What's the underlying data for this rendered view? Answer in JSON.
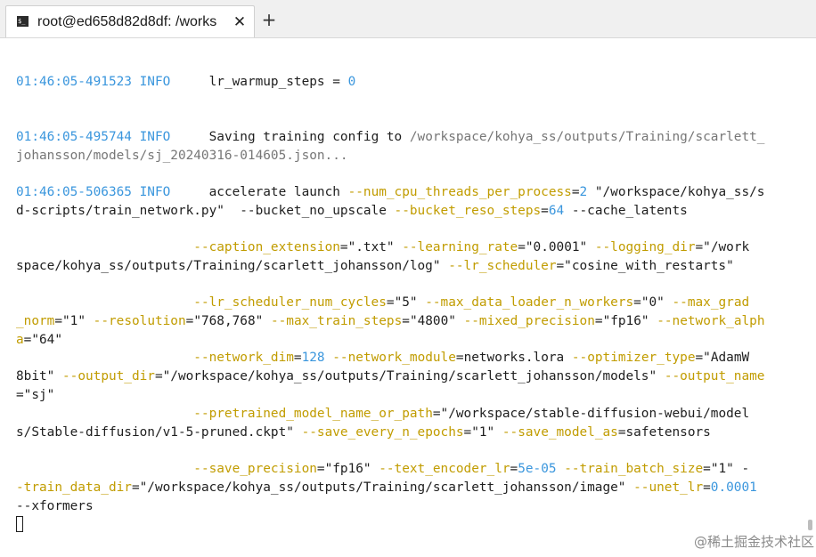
{
  "tab": {
    "title": "root@ed658d82d8df: /works",
    "icon": "terminal-icon",
    "icon_text": "$_",
    "close_glyph": "✕",
    "new_tab_glyph": "+"
  },
  "log": {
    "l1": {
      "ts": "01:46:05-491523",
      "lvl": "INFO",
      "msg": "lr_warmup_steps = ",
      "val": "0"
    },
    "l2": {
      "ts": "01:46:05-495744",
      "lvl": "INFO",
      "msg": "Saving training config to ",
      "path1": "/workspace/kohya_ss/outputs/Training/scarlett_",
      "path2": "johansson/models/sj_20240316-014605.json..."
    },
    "l3": {
      "ts": "01:46:05-506365",
      "lvl": "INFO",
      "msg": "accelerate launch "
    }
  },
  "args": {
    "a1": "--num_cpu_threads_per_process",
    "v1": "2",
    "a2": " \"/workspace/kohya_ss/s",
    "a2b": "d-scripts/train_network.py\"",
    "a3": "  --bucket_no_upscale ",
    "a4": "--bucket_reso_steps",
    "v4": "64",
    "a5": " --cache_latents",
    "a6": "--caption_extension",
    "v6": "\".txt\"",
    "a7": "--learning_rate",
    "v7": "\"0.0001\"",
    "a8": "--logging_dir",
    "v8": "\"/work",
    "v8b": "space/kohya_ss/outputs/Training/scarlett_johansson/log\"",
    "a9": "--lr_scheduler",
    "v9": "\"cosine_with_restarts\"",
    "a10": "--lr_scheduler_num_cycles",
    "v10": "\"5\"",
    "a11": "--max_data_loader_n_workers",
    "v11": "\"0\"",
    "a12": "--max_grad",
    "a12b": "_norm",
    "v12": "\"1\"",
    "a13": "--resolution",
    "v13": "\"768,768\"",
    "a14": "--max_train_steps",
    "v14": "\"4800\"",
    "a15": "--mixed_precision",
    "v15": "\"fp16\"",
    "a16": "--network_alph",
    "a16b": "a",
    "v16": "\"64\"",
    "a17": "--network_dim",
    "v17": "128",
    "a18": "--network_module",
    "v18": "networks.lora",
    "a19": "--optimizer_type",
    "v19": "\"AdamW",
    "v19b": "8bit\"",
    "a20": "--output_dir",
    "v20": "\"/workspace/kohya_ss/outputs/Training/scarlett_johansson/models\"",
    "a21": "--output_name",
    "v21": "\"sj\"",
    "a22": "--pretrained_model_name_or_path",
    "v22": "\"/workspace/stable-diffusion-webui/model",
    "v22b": "s/Stable-diffusion/v1-5-pruned.ckpt\"",
    "a23": "--save_every_n_epochs",
    "v23": "\"1\"",
    "a24": "--save_model_as",
    "v24": "safetensors",
    "a25": "--save_precision",
    "v25": "\"fp16\"",
    "a26": "--text_encoder_lr",
    "v26": "5e-05",
    "a27": "--train_batch_size",
    "v27": "\"1\"",
    "a28a": " -",
    "a28": "-train_data_dir",
    "v28": "\"/workspace/kohya_ss/outputs/Training/scarlett_johansson/image\"",
    "a29": "--unet_lr",
    "v29": "0.0001",
    "a30": "--xformers"
  },
  "symbols": {
    "eq": "=",
    "sp": " ",
    "eqsp": " = "
  },
  "watermark": "@稀土掘金技术社区",
  "colors": {
    "timestamp": "#3a96dd",
    "keyword": "#c19c00",
    "number": "#3a96dd",
    "path": "#767676"
  }
}
